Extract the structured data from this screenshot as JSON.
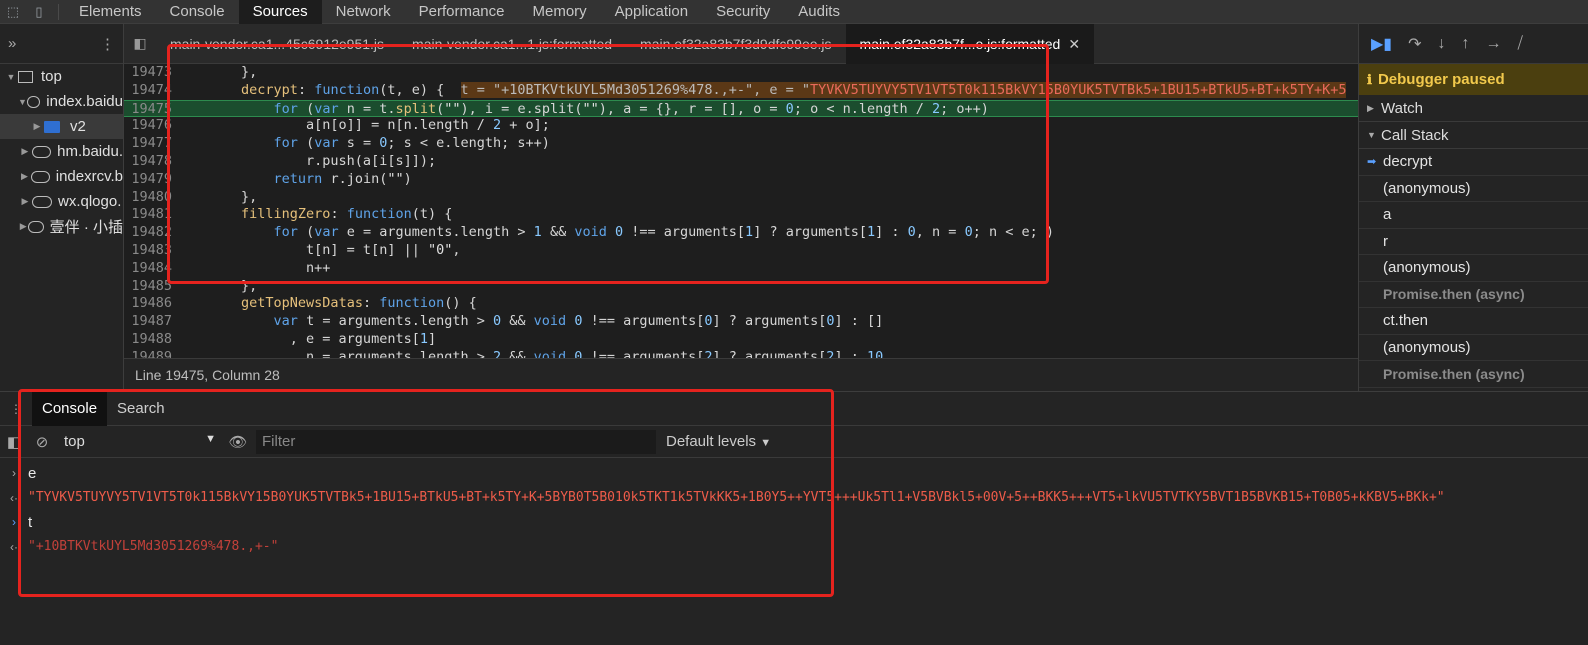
{
  "topbar": {
    "tabs": [
      "Elements",
      "Console",
      "Sources",
      "Network",
      "Performance",
      "Memory",
      "Application",
      "Security",
      "Audits"
    ],
    "active": "Sources"
  },
  "navigator": {
    "tree": [
      {
        "label": "top",
        "icon": "frame-icon",
        "arrow": "▼"
      },
      {
        "label": "index.baidu",
        "icon": "cloud-icon",
        "arrow": "▼"
      },
      {
        "label": "v2",
        "icon": "folder-icon",
        "arrow": "▶",
        "selected": true
      },
      {
        "label": "hm.baidu.",
        "icon": "cloud-icon",
        "arrow": "▶"
      },
      {
        "label": "indexrcv.b",
        "icon": "cloud-icon",
        "arrow": "▶"
      },
      {
        "label": "wx.qlogo.",
        "icon": "cloud-icon",
        "arrow": "▶"
      },
      {
        "label": "壹伴 · 小插",
        "icon": "cloud-icon",
        "arrow": "▶"
      }
    ]
  },
  "editor": {
    "file_tabs": [
      "main-vendor.ca1...45c6912e951.js",
      "main-vendor.ca1...1.js:formatted",
      "main.ef32a83b7f3d9dfc99ee.js",
      "main.ef32a83b7f...e.js:formatted"
    ],
    "active_file_tab": "main.ef32a83b7f...e.js:formatted",
    "status": "Line 19475, Column 28",
    "line_numbers": [
      "19473",
      "19474",
      "19475",
      "19476",
      "19477",
      "19478",
      "19479",
      "19480",
      "19481",
      "19482",
      "19483",
      "19484",
      "19485",
      "19486",
      "19487",
      "19488",
      "19489"
    ],
    "inline_t": "t = \"+10BTKVtkUYL5Md3051269%478.,+-\"",
    "inline_e_prefix": ", e = \"",
    "inline_e": "TYVKV5TUYVY5TV1VT5T0k115BkVY15B0YUK5TVTBk5+1BU15+BTkU5+BT+k5TY+K+5"
  },
  "debugger": {
    "paused": "Debugger paused",
    "watch": "Watch",
    "call_stack": "Call Stack",
    "frames": [
      "decrypt",
      "(anonymous)",
      "a",
      "r",
      "(anonymous)",
      "Promise.then (async)",
      "ct.then",
      "(anonymous)",
      "Promise.then (async)"
    ]
  },
  "drawer": {
    "tabs": [
      "Console",
      "Search"
    ],
    "context": "top",
    "filter_placeholder": "Filter",
    "levels": "Default levels",
    "log": [
      {
        "kind": "input",
        "text": "e"
      },
      {
        "kind": "output",
        "text": "\"TYVKV5TUYVY5TV1VT5T0k115BkVY15B0YUK5TVTBk5+1BU15+BTkU5+BT+k5TY+K+5BYB0T5B010k5TKT1k5TVkKK5+1B0Y5++YVT5+++Uk5Tl1+V5BVBkl5+00V+5++BKK5+++VT5+lkVU5TVTKY5BVT1B5BVKB15+T0B05+kKBV5+BKk+\""
      },
      {
        "kind": "input",
        "text": "t"
      },
      {
        "kind": "output",
        "text": "\"+10BTKVtkUYL5Md3051269%478.,+-\""
      }
    ]
  }
}
